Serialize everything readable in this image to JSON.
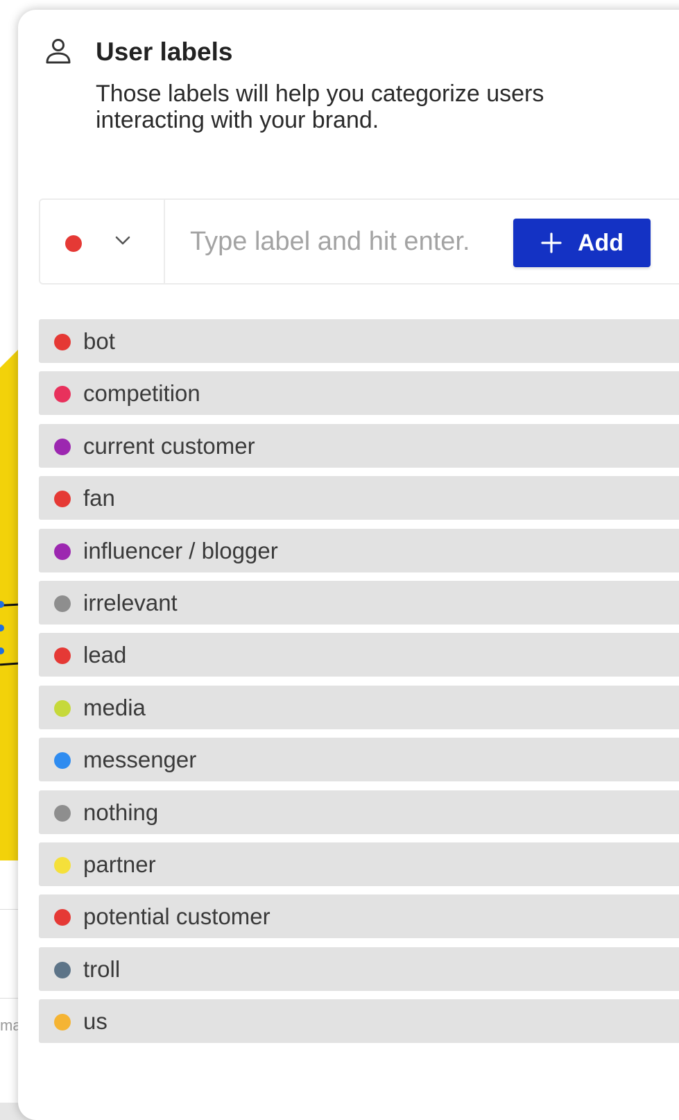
{
  "background": {
    "snippet_text": "ma"
  },
  "header": {
    "icon": "user-outline-icon",
    "title": "User labels",
    "subtitle": "Those labels will help you categorize users interacting with your brand."
  },
  "input": {
    "selected_color": "#e53935",
    "placeholder": "Type label and hit enter.",
    "value": "",
    "add_label": "Add",
    "add_color": "#1432c4"
  },
  "labels": [
    {
      "name": "bot",
      "color": "#e53935"
    },
    {
      "name": "competition",
      "color": "#e8315c"
    },
    {
      "name": "current customer",
      "color": "#9c27b0"
    },
    {
      "name": "fan",
      "color": "#e53935"
    },
    {
      "name": "influencer / blogger",
      "color": "#9c27b0"
    },
    {
      "name": "irrelevant",
      "color": "#8e8e8e"
    },
    {
      "name": "lead",
      "color": "#e53935"
    },
    {
      "name": "media",
      "color": "#c6d93a"
    },
    {
      "name": "messenger",
      "color": "#2f8cf0"
    },
    {
      "name": "nothing",
      "color": "#8e8e8e"
    },
    {
      "name": "partner",
      "color": "#f5e03a"
    },
    {
      "name": "potential customer",
      "color": "#e53935"
    },
    {
      "name": "troll",
      "color": "#5d7488"
    },
    {
      "name": "us",
      "color": "#f5b433"
    }
  ]
}
